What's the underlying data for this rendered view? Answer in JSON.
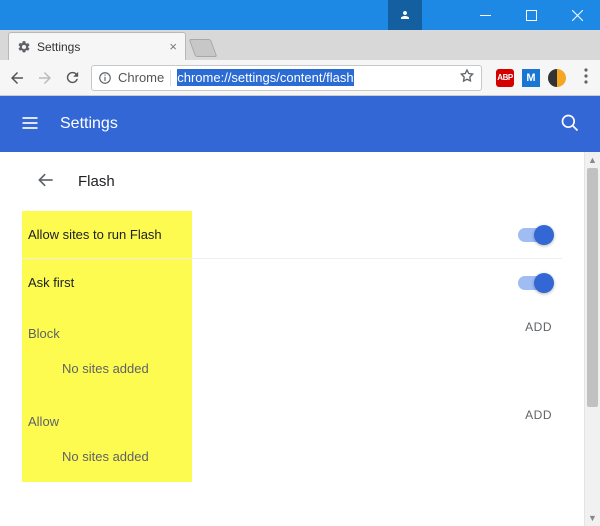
{
  "window": {
    "tab_title": "Settings",
    "url": "chrome://settings/content/flash"
  },
  "toolbar": {
    "scheme_label": "Chrome",
    "extensions": {
      "abp": "ABP",
      "m": "M"
    }
  },
  "header": {
    "title": "Settings"
  },
  "page": {
    "subtitle": "Flash",
    "allow_sites_label": "Allow sites to run Flash",
    "ask_first_label": "Ask first",
    "block_label": "Block",
    "allow_label": "Allow",
    "add_label": "ADD",
    "empty_label": "No sites added",
    "allow_sites_toggle": true,
    "ask_first_toggle": true
  }
}
